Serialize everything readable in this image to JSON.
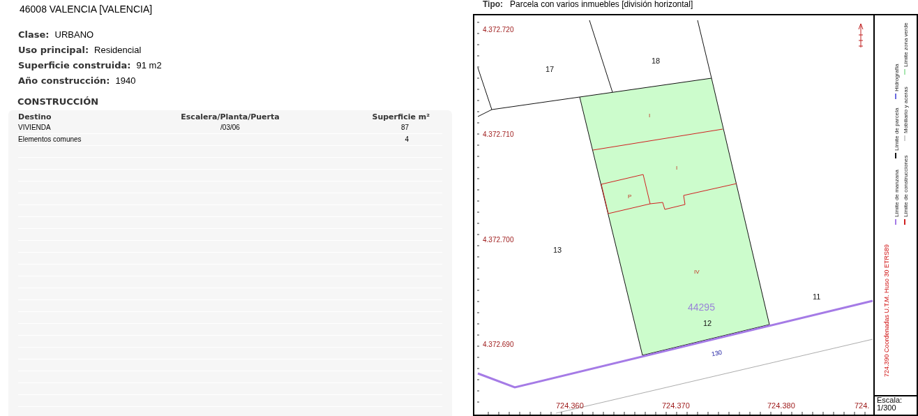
{
  "header": {
    "address": "46008 VALENCIA [VALENCIA]"
  },
  "fields": [
    {
      "label": "Clase:",
      "value": "URBANO"
    },
    {
      "label": "Uso principal:",
      "value": "Residencial"
    },
    {
      "label": "Superficie construida:",
      "value": "91 m2"
    },
    {
      "label": "Año construcción:",
      "value": "1940"
    }
  ],
  "construction": {
    "title": "CONSTRUCCIÓN",
    "columns": [
      "Destino",
      "Escalera/Planta/Puerta",
      "Superficie m²"
    ],
    "rows": [
      {
        "destino": "VIVIENDA",
        "escalera": "/03/06",
        "superficie": "87"
      },
      {
        "destino": "Elementos comunes",
        "superficie": "4"
      }
    ]
  },
  "tipo": {
    "label": "Tipo:",
    "value": "Parcela con varios inmuebles [división horizontal]"
  },
  "map": {
    "northing_labels": [
      "4.372.720",
      "4.372.710",
      "4.372.700",
      "4.372.690"
    ],
    "easting_labels": [
      "724.360",
      "724.370",
      "724.380",
      "724."
    ],
    "parcel_labels": [
      "17",
      "18",
      "13",
      "11",
      "12"
    ],
    "subparcel_labels": [
      "I",
      "I",
      "P",
      "IV"
    ],
    "cadastral_ref": "44295",
    "street_number": "130"
  },
  "legend": {
    "coordinates": "724.390 Coordenadas U.T.M. Huso 30 ETRS89",
    "items": [
      {
        "label": "Límite de manzana",
        "color": "#a57be6"
      },
      {
        "label": "Límite de construcciones",
        "color": "#d02020"
      },
      {
        "label": "Límite de parcela",
        "color": "#111111"
      },
      {
        "label": "Mobiliario y aceras",
        "color": "#cfcfcf"
      },
      {
        "label": "Hidrografía",
        "color": "#6a6ae0"
      },
      {
        "label": "Límite zona verde",
        "color": "#a8e6b0"
      }
    ],
    "scale_label": "Escala:",
    "scale": "1/300"
  }
}
